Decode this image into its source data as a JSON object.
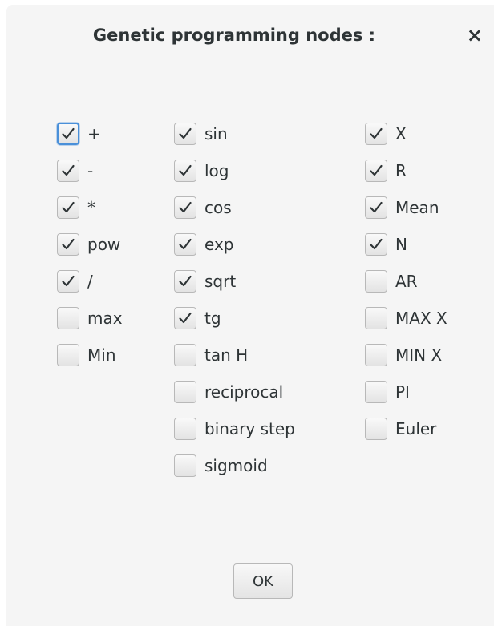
{
  "dialog": {
    "title": "Genetic programming nodes :",
    "close_icon": "close-icon",
    "close_glyph": "×",
    "ok_label": "OK"
  },
  "columns": [
    {
      "items": [
        {
          "label": "+",
          "checked": true,
          "focused": true
        },
        {
          "label": "-",
          "checked": true
        },
        {
          "label": "*",
          "checked": true
        },
        {
          "label": "pow",
          "checked": true
        },
        {
          "label": "/",
          "checked": true
        },
        {
          "label": "max",
          "checked": false
        },
        {
          "label": "Min",
          "checked": false
        }
      ]
    },
    {
      "items": [
        {
          "label": "sin",
          "checked": true
        },
        {
          "label": "log",
          "checked": true
        },
        {
          "label": "cos",
          "checked": true
        },
        {
          "label": "exp",
          "checked": true
        },
        {
          "label": "sqrt",
          "checked": true
        },
        {
          "label": "tg",
          "checked": true
        },
        {
          "label": "tan H",
          "checked": false
        },
        {
          "label": "reciprocal",
          "checked": false
        },
        {
          "label": "binary step",
          "checked": false
        },
        {
          "label": "sigmoid",
          "checked": false
        }
      ]
    },
    {
      "items": [
        {
          "label": "X",
          "checked": true
        },
        {
          "label": "R",
          "checked": true
        },
        {
          "label": "Mean",
          "checked": true
        },
        {
          "label": "N",
          "checked": true
        },
        {
          "label": "AR",
          "checked": false
        },
        {
          "label": "MAX X",
          "checked": false
        },
        {
          "label": "MIN X",
          "checked": false
        },
        {
          "label": "PI",
          "checked": false
        },
        {
          "label": "Euler",
          "checked": false
        }
      ]
    }
  ],
  "colors": {
    "focus_ring": "#4a90d9",
    "text": "#2e3436",
    "background": "#f5f5f5"
  }
}
